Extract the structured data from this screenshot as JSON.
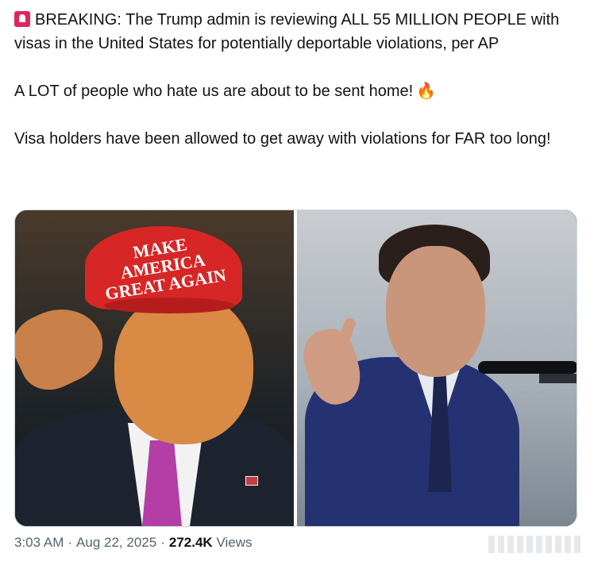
{
  "tweet": {
    "paragraphs": {
      "p1": "BREAKING: The Trump admin is reviewing ALL 55 MILLION PEOPLE with visas in the United States for potentially deportable violations, per AP",
      "p2": "A LOT of people who hate us are about to be sent home!",
      "p3": "Visa holders have been allowed to get away with violations for FAR too long!"
    },
    "icons": {
      "siren": "siren-icon",
      "fire": "fire-icon"
    },
    "fire_glyph": "🔥",
    "media": {
      "left_cap_text": "MAKE AMERICA GREAT AGAIN",
      "left_alt": "photo-left",
      "right_alt": "photo-right"
    },
    "meta": {
      "time": "3:03 AM",
      "date": "Aug 22, 2025",
      "views_count": "272.4K",
      "views_label": "Views",
      "separator": "·"
    },
    "colors": {
      "text": "#0f1419",
      "secondary": "#536471",
      "cap_red": "#d72626",
      "tie_purple": "#b23ea6",
      "suit_blue": "#253272"
    }
  }
}
